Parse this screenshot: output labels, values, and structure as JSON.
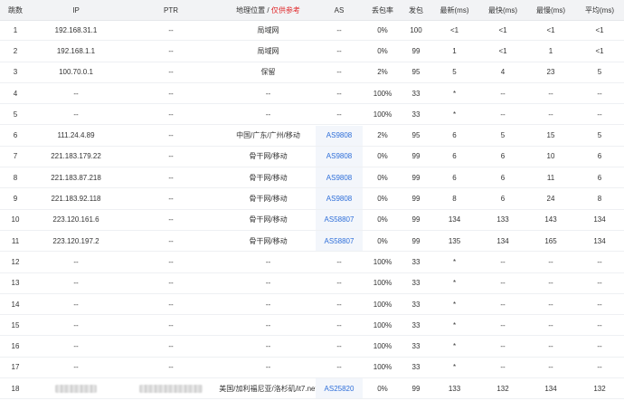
{
  "headers": {
    "hop": "跳数",
    "ip": "IP",
    "ptr": "PTR",
    "geo": "地理位置",
    "geo_sep": " / ",
    "geo_note": "仅供参考",
    "as": "AS",
    "loss": "丢包率",
    "sent": "发包",
    "last": "最新(ms)",
    "best": "最快(ms)",
    "worst": "最慢(ms)",
    "avg": "平均(ms)"
  },
  "rows": [
    {
      "hop": "1",
      "ip": "192.168.31.1",
      "ptr": "--",
      "geo": "局域网",
      "as": "--",
      "loss": "0%",
      "sent": "100",
      "last": "<1",
      "best": "<1",
      "worst": "<1",
      "avg": "<1"
    },
    {
      "hop": "2",
      "ip": "192.168.1.1",
      "ptr": "--",
      "geo": "局域网",
      "as": "--",
      "loss": "0%",
      "sent": "99",
      "last": "1",
      "best": "<1",
      "worst": "1",
      "avg": "<1"
    },
    {
      "hop": "3",
      "ip": "100.70.0.1",
      "ptr": "--",
      "geo": "保留",
      "as": "--",
      "loss": "2%",
      "sent": "95",
      "last": "5",
      "best": "4",
      "worst": "23",
      "avg": "5"
    },
    {
      "hop": "4",
      "ip": "--",
      "ptr": "--",
      "geo": "--",
      "as": "--",
      "loss": "100%",
      "sent": "33",
      "last": "*",
      "best": "--",
      "worst": "--",
      "avg": "--"
    },
    {
      "hop": "5",
      "ip": "--",
      "ptr": "--",
      "geo": "--",
      "as": "--",
      "loss": "100%",
      "sent": "33",
      "last": "*",
      "best": "--",
      "worst": "--",
      "avg": "--"
    },
    {
      "hop": "6",
      "ip": "111.24.4.89",
      "ptr": "--",
      "geo": "中国/广东/广州/移动",
      "as": "AS9808",
      "loss": "2%",
      "sent": "95",
      "last": "6",
      "best": "5",
      "worst": "15",
      "avg": "5"
    },
    {
      "hop": "7",
      "ip": "221.183.179.22",
      "ptr": "--",
      "geo": "骨干网/移动",
      "as": "AS9808",
      "loss": "0%",
      "sent": "99",
      "last": "6",
      "best": "6",
      "worst": "10",
      "avg": "6"
    },
    {
      "hop": "8",
      "ip": "221.183.87.218",
      "ptr": "--",
      "geo": "骨干网/移动",
      "as": "AS9808",
      "loss": "0%",
      "sent": "99",
      "last": "6",
      "best": "6",
      "worst": "11",
      "avg": "6"
    },
    {
      "hop": "9",
      "ip": "221.183.92.118",
      "ptr": "--",
      "geo": "骨干网/移动",
      "as": "AS9808",
      "loss": "0%",
      "sent": "99",
      "last": "8",
      "best": "6",
      "worst": "24",
      "avg": "8"
    },
    {
      "hop": "10",
      "ip": "223.120.161.6",
      "ptr": "--",
      "geo": "骨干网/移动",
      "as": "AS58807",
      "loss": "0%",
      "sent": "99",
      "last": "134",
      "best": "133",
      "worst": "143",
      "avg": "134"
    },
    {
      "hop": "11",
      "ip": "223.120.197.2",
      "ptr": "--",
      "geo": "骨干网/移动",
      "as": "AS58807",
      "loss": "0%",
      "sent": "99",
      "last": "135",
      "best": "134",
      "worst": "165",
      "avg": "134"
    },
    {
      "hop": "12",
      "ip": "--",
      "ptr": "--",
      "geo": "--",
      "as": "--",
      "loss": "100%",
      "sent": "33",
      "last": "*",
      "best": "--",
      "worst": "--",
      "avg": "--"
    },
    {
      "hop": "13",
      "ip": "--",
      "ptr": "--",
      "geo": "--",
      "as": "--",
      "loss": "100%",
      "sent": "33",
      "last": "*",
      "best": "--",
      "worst": "--",
      "avg": "--"
    },
    {
      "hop": "14",
      "ip": "--",
      "ptr": "--",
      "geo": "--",
      "as": "--",
      "loss": "100%",
      "sent": "33",
      "last": "*",
      "best": "--",
      "worst": "--",
      "avg": "--"
    },
    {
      "hop": "15",
      "ip": "--",
      "ptr": "--",
      "geo": "--",
      "as": "--",
      "loss": "100%",
      "sent": "33",
      "last": "*",
      "best": "--",
      "worst": "--",
      "avg": "--"
    },
    {
      "hop": "16",
      "ip": "--",
      "ptr": "--",
      "geo": "--",
      "as": "--",
      "loss": "100%",
      "sent": "33",
      "last": "*",
      "best": "--",
      "worst": "--",
      "avg": "--"
    },
    {
      "hop": "17",
      "ip": "--",
      "ptr": "--",
      "geo": "--",
      "as": "--",
      "loss": "100%",
      "sent": "33",
      "last": "*",
      "best": "--",
      "worst": "--",
      "avg": "--"
    },
    {
      "hop": "18",
      "ip": "",
      "ptr": "",
      "geo": "美国/加利福尼亚/洛杉矶/it7.net",
      "as": "AS25820",
      "loss": "0%",
      "sent": "99",
      "last": "133",
      "best": "132",
      "worst": "134",
      "avg": "132",
      "ip_redacted": true,
      "ptr_redacted": true
    }
  ],
  "colors": {
    "header_bg": "#f2f3f5",
    "as_link": "#2f6fd9",
    "warning": "#e0292b"
  }
}
